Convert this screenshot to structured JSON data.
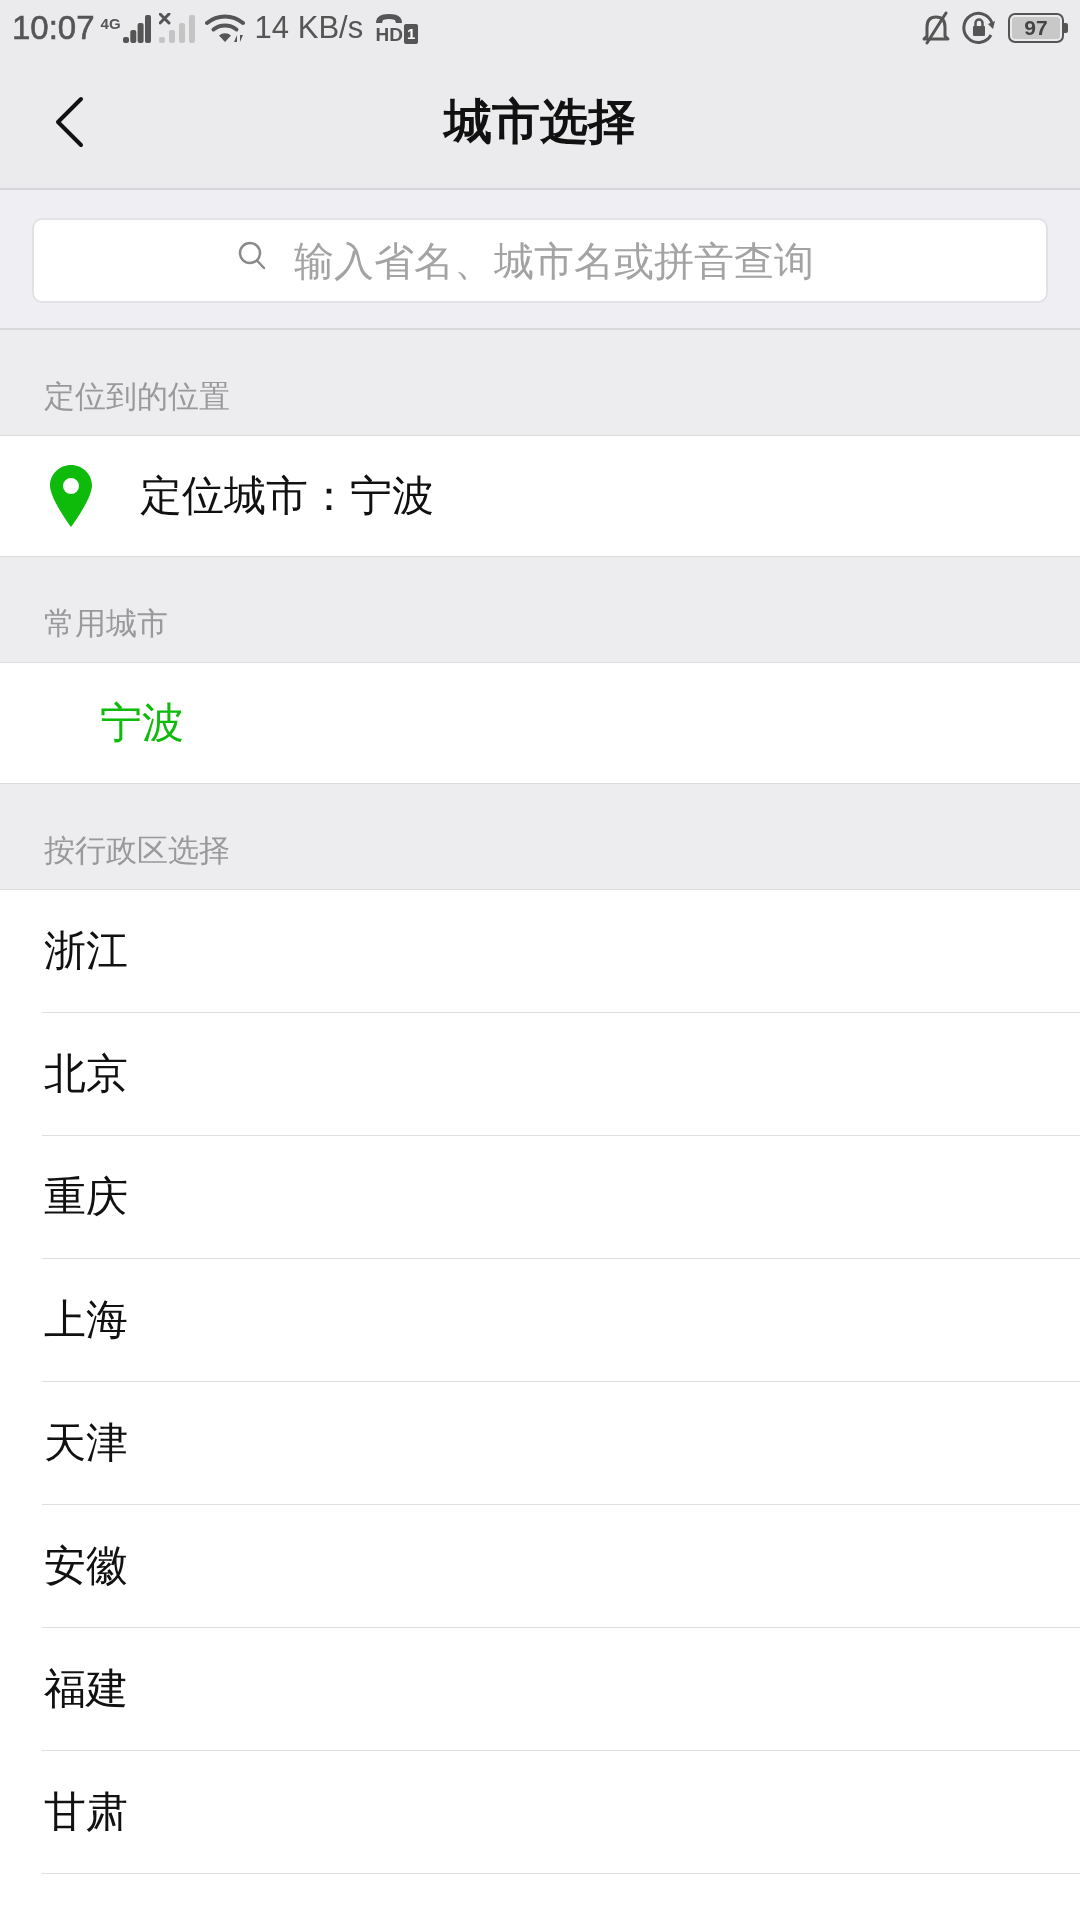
{
  "status_bar": {
    "time": "10:07",
    "network_type": "4G",
    "network_speed": "14 KB/s",
    "call_label": "HD",
    "sim_slot": "1",
    "battery": "97"
  },
  "nav_bar": {
    "title": "城市选择"
  },
  "search": {
    "placeholder": "输入省名、城市名或拼音查询"
  },
  "sections": [
    {
      "kind": "location",
      "title": "定位到的位置",
      "items": [
        {
          "label": "定位城市：宁波"
        }
      ]
    },
    {
      "kind": "frequent",
      "title": "常用城市",
      "items": [
        {
          "label": "宁波"
        }
      ]
    },
    {
      "kind": "region",
      "title": "按行政区选择",
      "items": [
        {
          "label": "浙江"
        },
        {
          "label": "北京"
        },
        {
          "label": "重庆"
        },
        {
          "label": "上海"
        },
        {
          "label": "天津"
        },
        {
          "label": "安徽"
        },
        {
          "label": "福建"
        },
        {
          "label": "甘肃"
        }
      ]
    }
  ]
}
